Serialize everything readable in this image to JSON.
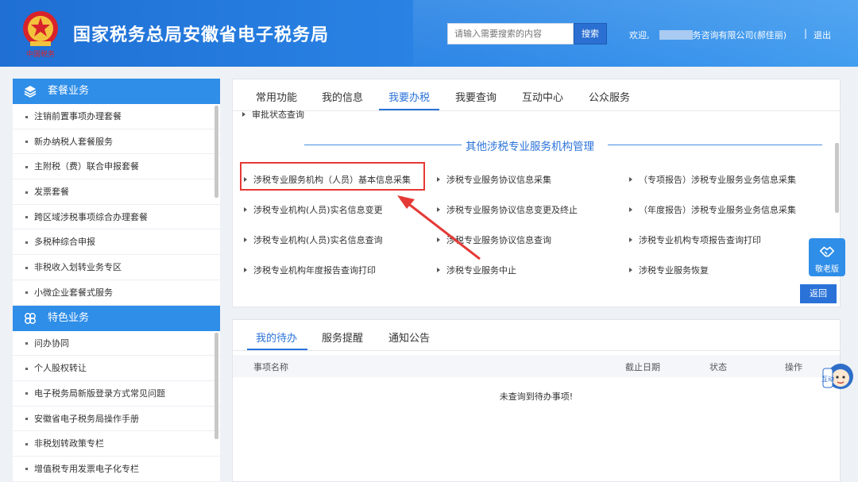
{
  "header": {
    "title": "国家税务总局安徽省电子税务局",
    "emblem_caption": "中国税务",
    "search_placeholder": "请输入需要搜索的内容",
    "search_button": "搜索",
    "welcome_prefix": "欢迎,",
    "user_company_suffix": "务咨询有限公司(郝佳丽)",
    "separator": "|",
    "logout": "退出"
  },
  "sidebar": {
    "sections": [
      {
        "title": "套餐业务",
        "icon": "layers-icon",
        "items": [
          "注销前置事项办理套餐",
          "新办纳税人套餐服务",
          "主附税（费）联合申报套餐",
          "发票套餐",
          "跨区域涉税事项综合办理套餐",
          "多税种综合申报",
          "非税收入划转业务专区",
          "小微企业套餐式服务"
        ]
      },
      {
        "title": "特色业务",
        "icon": "clover-icon",
        "items": [
          "问办协同",
          "个人股权转让",
          "电子税务局新版登录方式常见问题",
          "安徽省电子税务局操作手册",
          "非税划转政策专栏",
          "增值税专用发票电子化专栏"
        ]
      }
    ]
  },
  "main": {
    "tabs": [
      "常用功能",
      "我的信息",
      "我要办税",
      "我要查询",
      "互动中心",
      "公众服务"
    ],
    "active_tab": "我要办税",
    "prev_item": "审批状态查询",
    "group_title": "其他涉税专业服务机构管理",
    "links": [
      [
        "涉税专业服务机构（人员）基本信息采集",
        "涉税专业服务协议信息采集",
        "（专项报告）涉税专业服务业务信息采集"
      ],
      [
        "涉税专业机构(人员)实名信息变更",
        "涉税专业服务协议信息变更及终止",
        "（年度报告）涉税专业服务业务信息采集"
      ],
      [
        "涉税专业机构(人员)实名信息查询",
        "涉税专业服务协议信息查询",
        "涉税专业机构专项报告查询打印"
      ],
      [
        "涉税专业机构年度报告查询打印",
        "涉税专业服务中止",
        "涉税专业服务恢复"
      ]
    ],
    "back_button": "返回"
  },
  "elder_mode": {
    "label": "敬老版",
    "icon": "handshake-icon"
  },
  "todo": {
    "tabs": [
      "我的待办",
      "服务提醒",
      "通知公告"
    ],
    "active_tab": "我的待办",
    "columns": [
      "事项名称",
      "截止日期",
      "状态",
      "操作"
    ],
    "empty_text": "未查询到待办事项!"
  },
  "assistant": {
    "text": "互动",
    "icon": "robot-assistant-icon"
  },
  "colors": {
    "header_blue": "#2b86e6",
    "accent": "#2a72d8",
    "highlight_red": "#e53935",
    "sidebar_head": "#2f8ee8"
  }
}
